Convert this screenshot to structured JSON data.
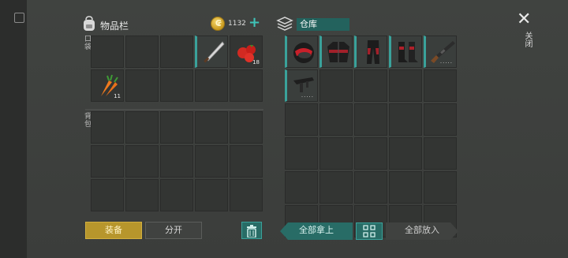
{
  "inventory": {
    "title": "物品栏",
    "coins": "1132",
    "plus_symbol": "+",
    "pocket_label": "口袋",
    "backpack_label": "背包",
    "pockets": [
      {
        "item": "",
        "qty": ""
      },
      {
        "item": "",
        "qty": ""
      },
      {
        "item": "",
        "qty": ""
      },
      {
        "item": "machete-icon",
        "qty": "",
        "selected": true
      },
      {
        "item": "tomatoes-icon",
        "qty": "18"
      },
      {
        "item": "carrots-icon",
        "qty": "11"
      },
      {
        "item": "",
        "qty": ""
      },
      {
        "item": "",
        "qty": ""
      },
      {
        "item": "",
        "qty": ""
      },
      {
        "item": "",
        "qty": ""
      }
    ],
    "backpack_slots": 15
  },
  "warehouse": {
    "title": "仓库",
    "items": [
      {
        "item": "helmet-icon",
        "selected": true
      },
      {
        "item": "jacket-icon",
        "selected": true
      },
      {
        "item": "pants-icon",
        "selected": true
      },
      {
        "item": "boots-icon",
        "selected": true
      },
      {
        "item": "shotgun-icon",
        "selected": true,
        "dots": "....."
      },
      {
        "item": "smg-icon",
        "selected": true,
        "dots": "....."
      }
    ],
    "slots": 30
  },
  "close": {
    "symbol": "✕",
    "label": "关闭"
  },
  "buttons": {
    "equip": "装备",
    "split": "分开",
    "take_all": "全部拿上",
    "put_all": "全部放入"
  },
  "colors": {
    "accent": "#3aa29b",
    "equip": "#b7962c"
  }
}
